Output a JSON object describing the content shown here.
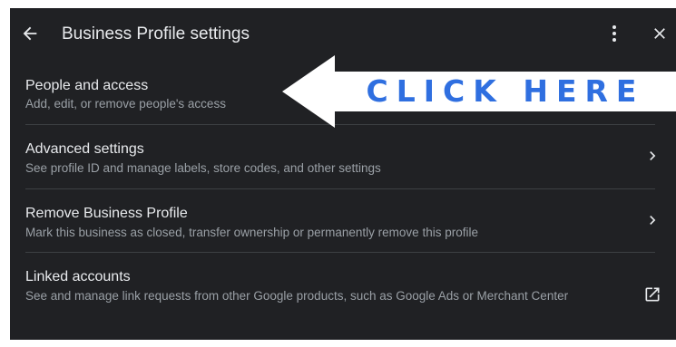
{
  "header": {
    "title": "Business Profile settings",
    "back_icon": "arrow-left-icon",
    "more_icon": "more-vert-icon",
    "close_icon": "close-icon"
  },
  "items": [
    {
      "title": "People and access",
      "description": "Add, edit, or remove people's access",
      "trailing": "none"
    },
    {
      "title": "Advanced settings",
      "description": "See profile ID and manage labels, store codes, and other settings",
      "trailing": "chevron-right-icon"
    },
    {
      "title": "Remove Business Profile",
      "description": "Mark this business as closed, transfer ownership or permanently remove this profile",
      "trailing": "chevron-right-icon"
    },
    {
      "title": "Linked accounts",
      "description": "See and manage link requests from other Google products, such as Google Ads or Merchant Center",
      "trailing": "open-in-new-icon"
    }
  ],
  "callout": {
    "text": "CLICK HERE",
    "text_color": "#2f6fe0",
    "arrow_color": "#ffffff"
  },
  "colors": {
    "panel_background": "#202124",
    "primary_text": "#e8eaed",
    "secondary_text": "#9aa0a6",
    "divider": "#3c4043"
  }
}
